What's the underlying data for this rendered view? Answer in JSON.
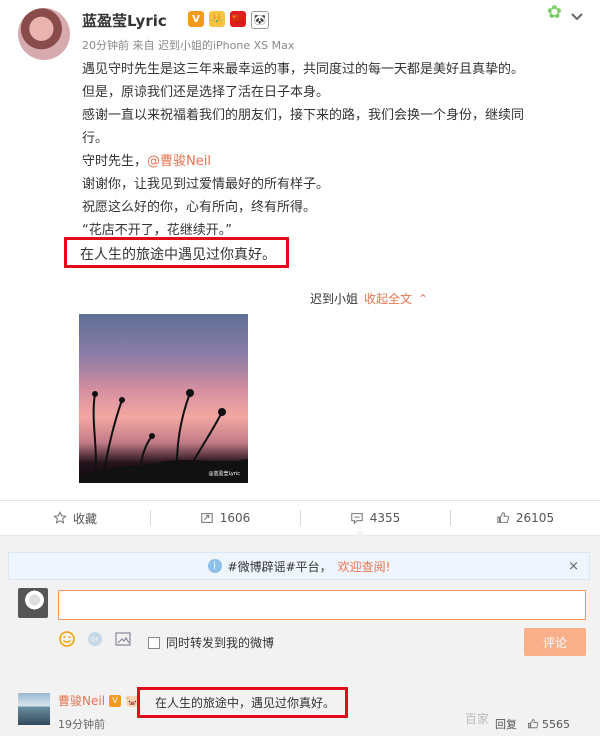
{
  "post": {
    "user": "蓝盈莹Lyric",
    "badges": [
      "V",
      "👑",
      "🇨🇳",
      "🐼"
    ],
    "meta": "20分钟前 来自 迟到小姐的iPhone XS Max",
    "lines": [
      "遇见守时先生是这三年来最幸运的事，共同度过的每一天都是美好且真挚的。",
      "但是，原谅我们还是选择了活在日子本身。",
      "感谢一直以来祝福着我们的朋友们，接下来的路，我们会换一个身份，继续同",
      "行。",
      "守时先生，",
      "谢谢你，让我见到过爱情最好的所有样子。",
      "祝愿这么好的你，心有所向，终有所得。",
      "“花店不开了，花继续开。”"
    ],
    "mention": "@曹骏Neil",
    "highlight": "在人生的旅途中遇见过你真好。",
    "collapse_prefix": "迟到小姐",
    "collapse_link": "收起全文",
    "photo_watermark": "@蓝盈莹Lyric"
  },
  "actions": {
    "fav": "收藏",
    "repost": "1606",
    "comment": "4355",
    "like": "26105"
  },
  "notice": {
    "prefix": "#微博辟谣#平台，",
    "link": "欢迎查阅!",
    "close": "×"
  },
  "comment_box": {
    "checkbox_label": "同时转发到我的微博",
    "submit": "评论"
  },
  "reply": {
    "user": "曹骏Neil",
    "text": "在人生的旅途中，遇见过你真好。",
    "time": "19分钟前",
    "reply_label": "回复",
    "likes": "5565",
    "watermark": "百家"
  },
  "colors": {
    "accent": "#eb7350",
    "highlight_border": "#e10b1c",
    "submit": "#f9b08a",
    "panel": "#f2f2f2"
  }
}
